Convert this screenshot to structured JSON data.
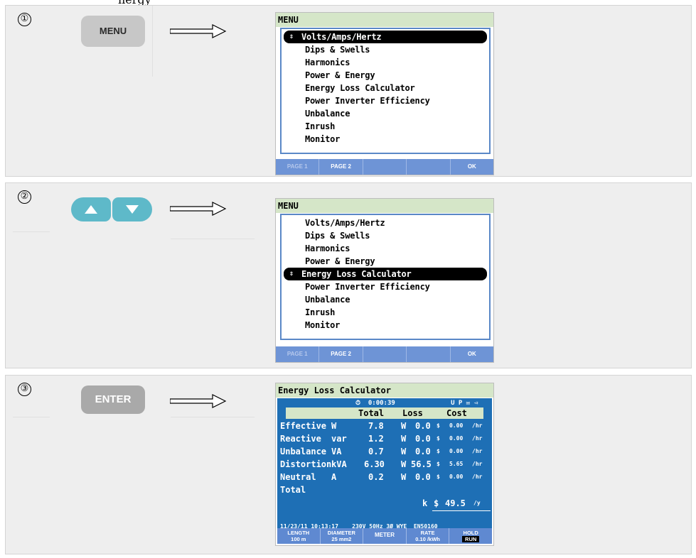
{
  "colors": {
    "panel_bg": "#eeeeee",
    "screen_title_bg": "#d5e6c8",
    "menu_border": "#5a88c7",
    "softkey_bg": "#6e94d6",
    "calc_bg": "#1e6fb5",
    "arrow_key": "#5eb9c9"
  },
  "header_text": "nergy",
  "steps": [
    {
      "number": "①",
      "key_label": "MENU"
    },
    {
      "number": "②",
      "keys": [
        "up-arrow-icon",
        "down-arrow-icon"
      ]
    },
    {
      "number": "③",
      "key_label": "ENTER"
    }
  ],
  "menu_screen": {
    "title": "MENU",
    "items": [
      "Volts/Amps/Hertz",
      "Dips & Swells",
      "Harmonics",
      "Power & Energy",
      "Energy Loss Calculator",
      "Power Inverter Efficiency",
      "Unbalance",
      "Inrush",
      "Monitor"
    ],
    "selection_marker": "⇕",
    "softkeys": [
      "PAGE 1",
      "PAGE 2",
      "",
      "",
      "OK"
    ]
  },
  "calc_screen": {
    "title": "Energy Loss Calculator",
    "timer_icon": "⏱",
    "timer": "0:00:39",
    "status_icons": "U P ✉ ◅",
    "columns": [
      "Total",
      "Loss",
      "Cost"
    ],
    "rows": [
      {
        "label": "Effective",
        "unit": "W",
        "total": "7.8",
        "loss_unit": "W",
        "loss": "0.0",
        "cur": "$",
        "cost": "0.00",
        "rate": "/hr"
      },
      {
        "label": "Reactive",
        "unit": "var",
        "total": "1.2",
        "loss_unit": "W",
        "loss": "0.0",
        "cur": "$",
        "cost": "0.00",
        "rate": "/hr"
      },
      {
        "label": "Unbalance",
        "unit": "VA",
        "total": "0.7",
        "loss_unit": "W",
        "loss": "0.0",
        "cur": "$",
        "cost": "0.00",
        "rate": "/hr"
      },
      {
        "label": "Distortion",
        "unit": "kVA",
        "total": "6.30",
        "loss_unit": "W",
        "loss": "56.5",
        "cur": "$",
        "cost": "5.65",
        "rate": "/hr"
      },
      {
        "label": "Neutral",
        "unit": "A",
        "total": "0.2",
        "loss_unit": "W",
        "loss": "0.0",
        "cur": "$",
        "cost": "0.00",
        "rate": "/hr"
      }
    ],
    "total_row": {
      "label": "Total",
      "prefix": "k",
      "cur": "$",
      "value": "49.5",
      "rate": "/y"
    },
    "footer": {
      "date": "11/23/11",
      "time": "10:13:17",
      "voltage": "230V",
      "freq": "50Hz",
      "config": "3Ø WYE",
      "standard": "EN50160"
    },
    "softkeys": [
      {
        "line1": "LENGTH",
        "line2": "100 m"
      },
      {
        "line1": "DIAMETER",
        "line2": "25 mm2"
      },
      {
        "line1": "METER",
        "line2": ""
      },
      {
        "line1": "RATE",
        "line2": "0.10 /kWh"
      },
      {
        "line1": "HOLD",
        "line2": "RUN"
      }
    ]
  }
}
